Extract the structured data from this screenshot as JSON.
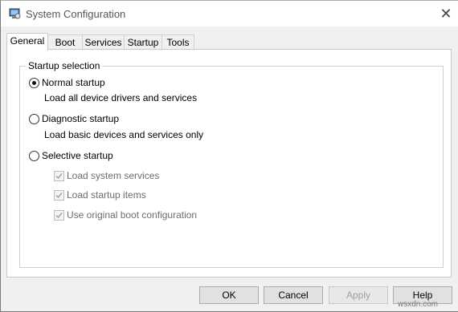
{
  "window": {
    "title": "System Configuration",
    "icon": "msconfig-icon",
    "close_glyph": "✕"
  },
  "tabs": [
    {
      "label": "General",
      "active": true
    },
    {
      "label": "Boot",
      "active": false
    },
    {
      "label": "Services",
      "active": false
    },
    {
      "label": "Startup",
      "active": false
    },
    {
      "label": "Tools",
      "active": false
    }
  ],
  "startup_selection": {
    "legend": "Startup selection",
    "options": [
      {
        "label": "Normal startup",
        "description": "Load all device drivers and services",
        "selected": true
      },
      {
        "label": "Diagnostic startup",
        "description": "Load basic devices and services only",
        "selected": false
      },
      {
        "label": "Selective startup",
        "description": "",
        "selected": false
      }
    ],
    "selective_items": [
      {
        "label": "Load system services",
        "checked": true,
        "enabled": false
      },
      {
        "label": "Load startup items",
        "checked": true,
        "enabled": false
      },
      {
        "label": "Use original boot configuration",
        "checked": true,
        "enabled": false
      }
    ]
  },
  "buttons": {
    "ok": "OK",
    "cancel": "Cancel",
    "apply": "Apply",
    "help": "Help"
  },
  "watermark": "wsxdn.com"
}
